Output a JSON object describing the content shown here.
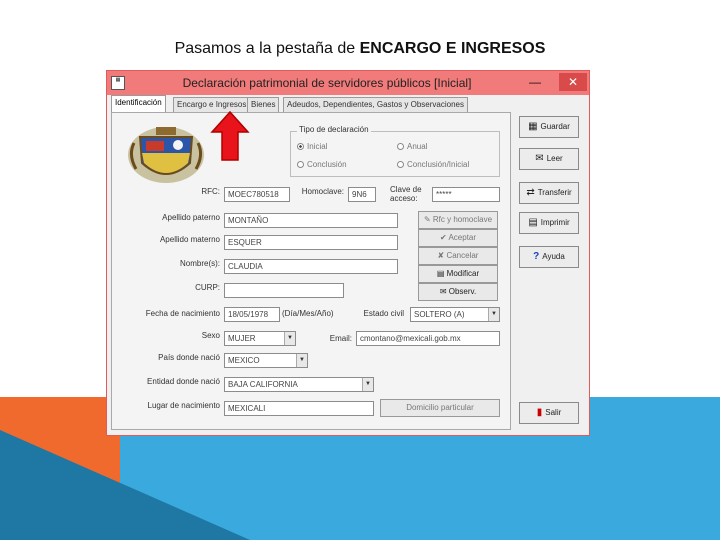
{
  "slide": {
    "title_prefix": "Pasamos a la pestaña de ",
    "title_bold": "ENCARGO E INGRESOS"
  },
  "window": {
    "title": "Declaración patrimonial de servidores públicos [Inicial]",
    "min_glyph": "—",
    "max_glyph": "□",
    "close_glyph": "✕",
    "tabs": [
      {
        "label": "Identificación",
        "active": true
      },
      {
        "label": "Encargo e Ingresos",
        "active": false
      },
      {
        "label": "Bienes",
        "active": false
      },
      {
        "label": "Adeudos, Dependientes, Gastos y Observaciones",
        "active": false
      }
    ]
  },
  "declaration_type": {
    "group_label": "Tipo de declaración",
    "options": [
      "Inicial",
      "Anual",
      "Conclusión",
      "Conclusión/Inicial"
    ],
    "selected": "Inicial"
  },
  "form": {
    "rfc_label": "RFC:",
    "rfc_value": "MOEC780518",
    "homoclave_label": "Homoclave:",
    "homoclave_value": "9N6",
    "clave_label": "Clave de acceso:",
    "clave_value": "*****",
    "apellido_paterno_label": "Apellido paterno",
    "apellido_paterno_value": "MONTAÑO",
    "apellido_materno_label": "Apellido materno",
    "apellido_materno_value": "ESQUER",
    "nombres_label": "Nombre(s):",
    "nombres_value": "CLAUDIA",
    "curp_label": "CURP:",
    "curp_value": "",
    "fecha_label": "Fecha de nacimiento",
    "fecha_value": "18/05/1978",
    "fecha_hint": "(Día/Mes/Año)",
    "estado_civil_label": "Estado civil",
    "estado_civil_value": "SOLTERO (A)",
    "sexo_label": "Sexo",
    "sexo_value": "MUJER",
    "email_label": "Email:",
    "email_value": "cmontano@mexicali.gob.mx",
    "pais_label": "País donde nació",
    "pais_value": "MEXICO",
    "entidad_label": "Entidad donde nació",
    "entidad_value": "BAJA CALIFORNIA",
    "lugar_label": "Lugar de nacimiento",
    "lugar_value": "MEXICALI"
  },
  "side_buttons": {
    "rfc_homoclave": "Rfc y homoclave",
    "aceptar": "Aceptar",
    "cancelar": "Cancelar",
    "modificar": "Modificar",
    "observ": "Observ.",
    "domicilio": "Domicilio particular"
  },
  "right_buttons": {
    "guardar": "Guardar",
    "leer": "Leer",
    "transferir": "Transferir",
    "imprimir": "Imprimir",
    "ayuda": "Ayuda",
    "salir": "Salir"
  },
  "colors": {
    "titlebar": "#f17a7a",
    "arrow": "#e8131b",
    "slide_blue": "#3aa9dd",
    "slide_orange": "#f06a2e"
  }
}
